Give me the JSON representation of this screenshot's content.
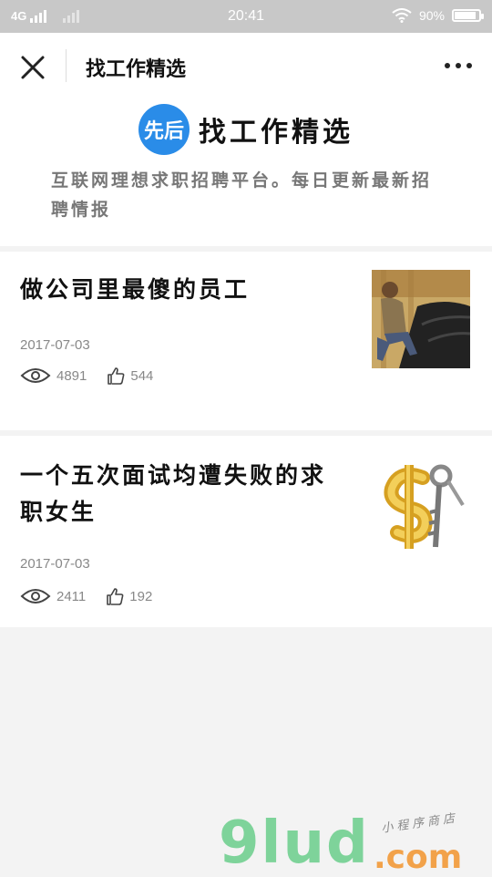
{
  "status_bar": {
    "network": "4G",
    "time": "20:41",
    "battery_percent": "90%",
    "battery_level": 0.9,
    "icons": [
      "signal-icon",
      "wifi-icon",
      "battery-icon"
    ]
  },
  "nav": {
    "title": "找工作精选",
    "close_icon": "close-icon",
    "more_icon": "more-icon"
  },
  "header": {
    "logo_text": "先后",
    "name": "找工作精选",
    "description": "互联网理想求职招聘平台。每日更新最新招聘情报",
    "accent": "#2a8ce8"
  },
  "articles": [
    {
      "title": "做公司里最傻的员工",
      "date": "2017-07-03",
      "views": "4891",
      "likes": "544"
    },
    {
      "title": "一个五次面试均遭失败的求职女生",
      "date": "2017-07-03",
      "views": "2411",
      "likes": "192"
    }
  ],
  "watermark": {
    "brand": "9lud",
    "domain": ".com",
    "tagline": "小程序商店"
  }
}
